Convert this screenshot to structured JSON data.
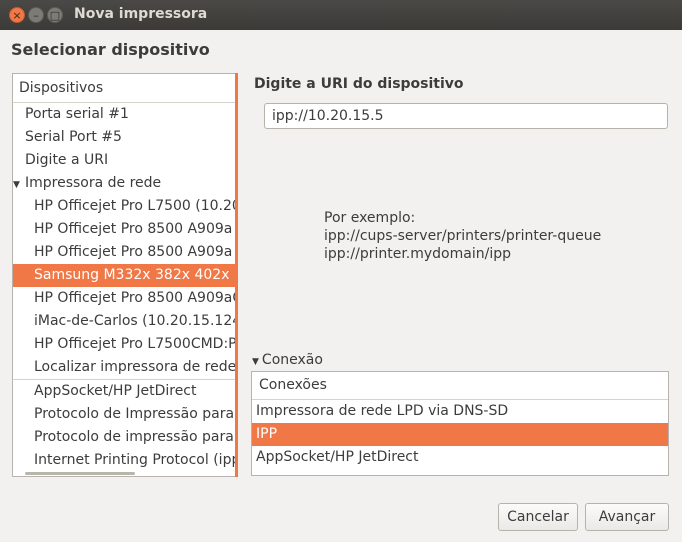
{
  "window": {
    "title": "Nova impressora",
    "controls": {
      "close": "×",
      "minimize": "–",
      "maximize": "□"
    }
  },
  "heading": "Selecionar dispositivo",
  "devices": {
    "header": "Dispositivos",
    "items": [
      {
        "label": "Porta serial #1",
        "level": 0
      },
      {
        "label": "Serial Port #5",
        "level": 0
      },
      {
        "label": "Digite a URI",
        "level": 0
      },
      {
        "label": "Impressora de rede",
        "level": 0,
        "expanded": true
      },
      {
        "label": "HP Officejet Pro L7500 (10.20.",
        "level": 1
      },
      {
        "label": "HP Officejet Pro 8500 A909a (1",
        "level": 1
      },
      {
        "label": "HP Officejet Pro 8500 A909a ([",
        "level": 1
      },
      {
        "label": "Samsung M332x 382x 402x (10",
        "level": 1,
        "selected": true
      },
      {
        "label": "HP Officejet Pro 8500 A909aCM",
        "level": 1
      },
      {
        "label": "iMac-de-Carlos (10.20.15.124)",
        "level": 1
      },
      {
        "label": "HP Officejet Pro L7500CMD:PC",
        "level": 1
      },
      {
        "label": "Localizar impressora de rede",
        "level": 1
      },
      {
        "label": "AppSocket/HP JetDirect",
        "level": 1
      },
      {
        "label": "Protocolo de Impressão para i",
        "level": 1
      },
      {
        "label": "Protocolo de impressão para i",
        "level": 1
      },
      {
        "label": "Internet Printing Protocol (ipp:",
        "level": 1
      }
    ]
  },
  "uri": {
    "label": "Digite a URI do dispositivo",
    "value": "ipp://10.20.15.5"
  },
  "example": {
    "line1": "Por exemplo:",
    "line2": "ipp://cups-server/printers/printer-queue",
    "line3": "ipp://printer.mydomain/ipp"
  },
  "connection": {
    "expander": "Conexão",
    "header": "Conexões",
    "items": [
      {
        "label": "Impressora de rede LPD via DNS-SD"
      },
      {
        "label": "IPP",
        "selected": true
      },
      {
        "label": "AppSocket/HP JetDirect"
      }
    ]
  },
  "buttons": {
    "cancel": "Cancelar",
    "next": "Avançar"
  },
  "colors": {
    "accent": "#f07746",
    "titlebar": "#3b3a37",
    "background": "#f2f1f0"
  }
}
